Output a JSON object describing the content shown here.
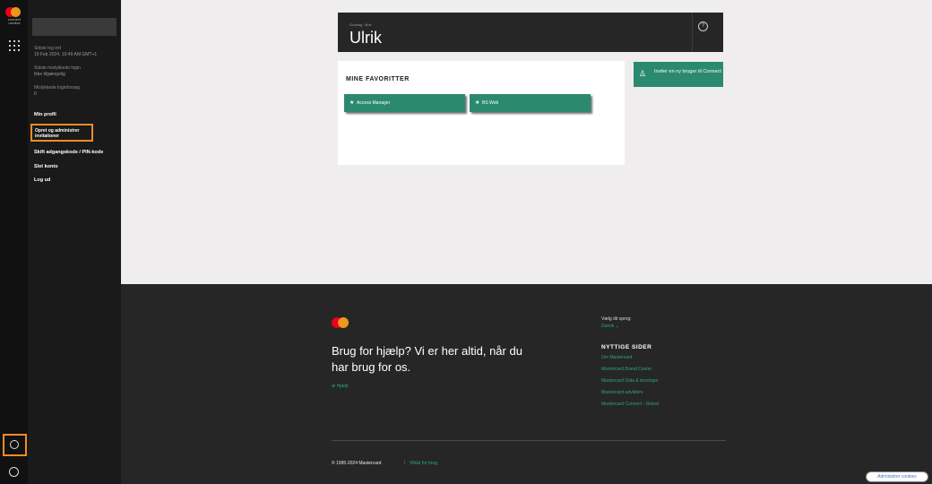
{
  "rail": {
    "logo_text": "connect nordics",
    "icons": [
      "apps-grid-icon",
      "user-circle-icon",
      "globe-icon"
    ]
  },
  "sidebar": {
    "last_login_label": "Sidste log ind",
    "last_login_value": "19 Feb 2024, 10:49 AM GMT+1",
    "failed_login_label": "Sidste mislykkede login",
    "failed_login_value": "Ikke tilgængelig",
    "failed_attempts_label": "Mislykkede loginforsøg",
    "failed_attempts_value": "0",
    "items": [
      {
        "label": "Min profil"
      },
      {
        "label": "Opret og administrer invitationer"
      },
      {
        "label": "Skift adgangskode / PIN-kode"
      },
      {
        "label": "Slet konto"
      },
      {
        "label": "Log ud"
      }
    ]
  },
  "header": {
    "subtitle": "Goddag, Ulrik",
    "title": "Ulrik",
    "help_glyph": "?"
  },
  "favorites": {
    "title": "MINE FAVORITTER",
    "items": [
      {
        "label": "Access Manager"
      },
      {
        "label": "BS Web"
      }
    ]
  },
  "invite_button": {
    "label": "Inviter en ny bruger til Connect"
  },
  "footer": {
    "help_text": "Brug for hjælp? Vi er her altid, når du har brug for os.",
    "help_link": "Hjælp",
    "language_label": "Vælg dit sprog:",
    "language_value": "Dansk ⌄",
    "useful_title": "NYTTIGE SIDER",
    "useful_links": [
      "Om Mastercard",
      "Mastercard Brand Center",
      "Mastercard Data & løsninger",
      "Mastercard-udviklere",
      "Mastercard Connect - Global"
    ],
    "copyright": "© 1995-2024 Mastercard",
    "terms": "Vilkår for brug"
  },
  "cookie_button": "Administrer cookies",
  "colors": {
    "accent_green": "#2b8a6e",
    "highlight_orange": "#f28c28",
    "mastercard_red": "#eb001b",
    "mastercard_yellow": "#f79e1b"
  }
}
